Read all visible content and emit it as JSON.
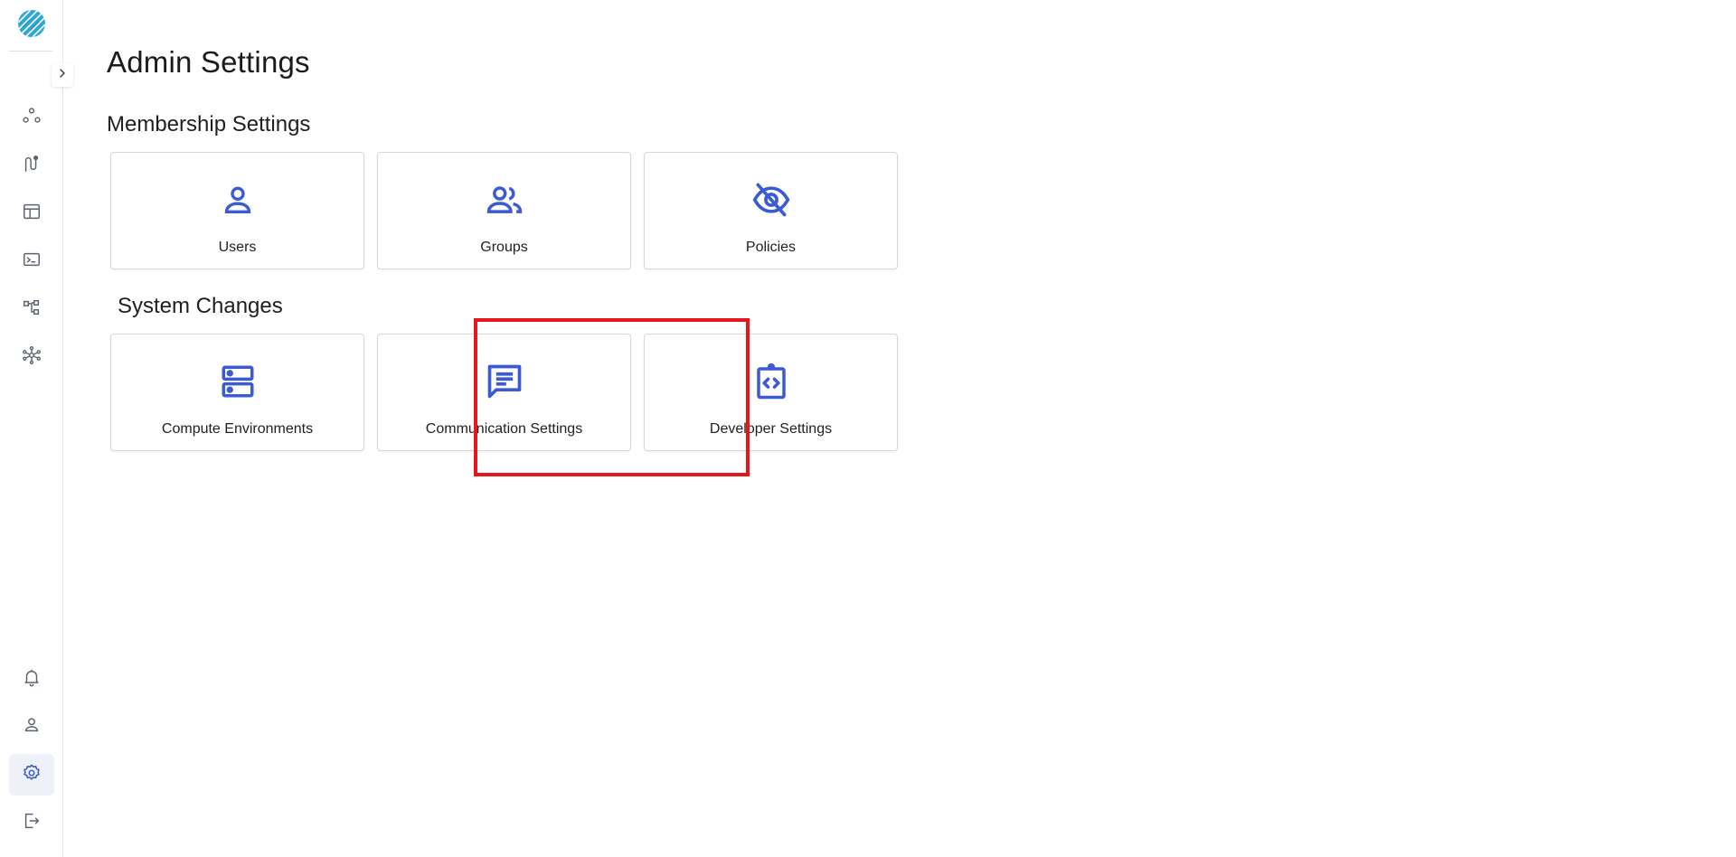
{
  "page": {
    "title": "Admin Settings"
  },
  "colors": {
    "accent": "#3a5bd4",
    "icon_gray": "#5a6470",
    "highlight": "#e8151b",
    "active_bg": "#eef2f8"
  },
  "sidebar": {
    "logo_icon": "brand-logo-icon",
    "collapse_icon": "chevron-right-icon",
    "top_items": [
      {
        "icon": "hierarchy-nodes-icon"
      },
      {
        "icon": "pipeline-route-icon"
      },
      {
        "icon": "table-layout-icon"
      },
      {
        "icon": "terminal-icon"
      },
      {
        "icon": "workflow-tree-icon"
      },
      {
        "icon": "network-hub-icon"
      }
    ],
    "bottom_items": [
      {
        "icon": "bell-icon"
      },
      {
        "icon": "user-icon"
      },
      {
        "icon": "gear-icon",
        "active": true
      },
      {
        "icon": "logout-icon"
      }
    ]
  },
  "sections": [
    {
      "title": "Membership Settings",
      "cards": [
        {
          "label": "Users",
          "icon": "user-icon"
        },
        {
          "label": "Groups",
          "icon": "groups-icon"
        },
        {
          "label": "Policies",
          "icon": "eye-off-icon"
        }
      ]
    },
    {
      "title": "System Changes",
      "cards": [
        {
          "label": "Compute Environments",
          "icon": "server-icon"
        },
        {
          "label": "Communication Settings",
          "icon": "chat-message-icon",
          "highlighted": true
        },
        {
          "label": "Developer Settings",
          "icon": "code-clipboard-icon"
        }
      ]
    }
  ]
}
